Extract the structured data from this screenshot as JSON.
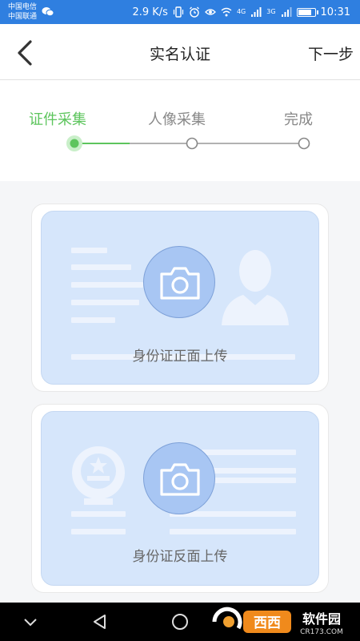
{
  "status_bar": {
    "carrier_1": "中国电信",
    "carrier_2": "中国联通",
    "speed": "2.9 K/s",
    "network_1": "4G",
    "network_2": "3G",
    "time": "10:31"
  },
  "navbar": {
    "title": "实名认证",
    "next_label": "下一步"
  },
  "steps": {
    "items": [
      "证件采集",
      "人像采集",
      "完成"
    ],
    "current": 1,
    "active_color": "#5dc55d"
  },
  "cards": {
    "front_label": "身份证正面上传",
    "back_label": "身份证反面上传"
  },
  "watermark": {
    "brand": "西西软件园",
    "domain": "CR173.COM"
  },
  "colors": {
    "status_bar": "#2f7fe0",
    "card_fill": "#d6e6fb",
    "camera_fill": "#a8c6f3"
  }
}
